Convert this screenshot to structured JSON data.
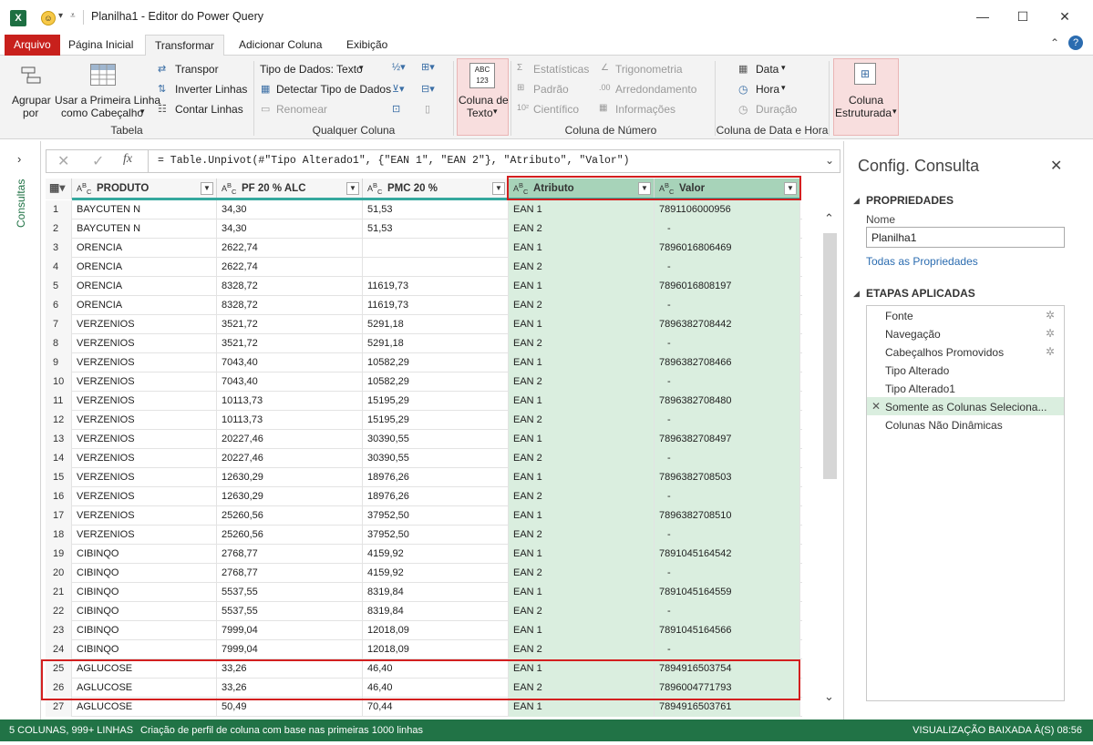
{
  "title": "Planilha1 - Editor do Power Query",
  "tabs": [
    "Arquivo",
    "Página Inicial",
    "Transformar",
    "Adicionar Coluna",
    "Exibição"
  ],
  "ribbon": {
    "agrupar": "Agrupar",
    "agrupar2": "por",
    "usar": "Usar a Primeira Linha",
    "usar2": "como Cabeçalho",
    "transpor": "Transpor",
    "inverter": "Inverter Linhas",
    "contar": "Contar Linhas",
    "tabela": "Tabela",
    "tipo_dados": "Tipo de Dados: Texto",
    "detectar": "Detectar Tipo de Dados",
    "renomear": "Renomear",
    "qualquer": "Qualquer Coluna",
    "coluna_de": "Coluna de",
    "texto": "Texto",
    "estatisticas": "Estatísticas",
    "padrao": "Padrão",
    "cientifico": "Científico",
    "trigonometria": "Trigonometria",
    "arredondamento": "Arredondamento",
    "informacoes": "Informações",
    "coluna_numero": "Coluna de Número",
    "data": "Data",
    "hora": "Hora",
    "duracao": "Duração",
    "coluna_data_hora": "Coluna de Data e Hora",
    "coluna": "Coluna",
    "estruturada": "Estruturada",
    "abc": "ABC",
    "n123": "123"
  },
  "consultas": "Consultas",
  "formula": "= Table.Unpivot(#\"Tipo Alterado1\", {\"EAN 1\", \"EAN 2\"}, \"Atributo\", \"Valor\")",
  "columns": [
    "PRODUTO",
    "PF 20 % ALC",
    "PMC 20 %",
    "Atributo",
    "Valor"
  ],
  "rows": [
    [
      "1",
      "BAYCUTEN N",
      "34,30",
      "51,53",
      "EAN 1",
      "7891106000956"
    ],
    [
      "2",
      "BAYCUTEN N",
      "34,30",
      "51,53",
      "EAN 2",
      "-"
    ],
    [
      "3",
      "ORENCIA",
      "2622,74",
      "",
      "EAN 1",
      "7896016806469"
    ],
    [
      "4",
      "ORENCIA",
      "2622,74",
      "",
      "EAN 2",
      "-"
    ],
    [
      "5",
      "ORENCIA",
      "8328,72",
      "11619,73",
      "EAN 1",
      "7896016808197"
    ],
    [
      "6",
      "ORENCIA",
      "8328,72",
      "11619,73",
      "EAN 2",
      "-"
    ],
    [
      "7",
      "VERZENIOS",
      "3521,72",
      "5291,18",
      "EAN 1",
      "7896382708442"
    ],
    [
      "8",
      "VERZENIOS",
      "3521,72",
      "5291,18",
      "EAN 2",
      "-"
    ],
    [
      "9",
      "VERZENIOS",
      "7043,40",
      "10582,29",
      "EAN 1",
      "7896382708466"
    ],
    [
      "10",
      "VERZENIOS",
      "7043,40",
      "10582,29",
      "EAN 2",
      "-"
    ],
    [
      "11",
      "VERZENIOS",
      "10113,73",
      "15195,29",
      "EAN 1",
      "7896382708480"
    ],
    [
      "12",
      "VERZENIOS",
      "10113,73",
      "15195,29",
      "EAN 2",
      "-"
    ],
    [
      "13",
      "VERZENIOS",
      "20227,46",
      "30390,55",
      "EAN 1",
      "7896382708497"
    ],
    [
      "14",
      "VERZENIOS",
      "20227,46",
      "30390,55",
      "EAN 2",
      "-"
    ],
    [
      "15",
      "VERZENIOS",
      "12630,29",
      "18976,26",
      "EAN 1",
      "7896382708503"
    ],
    [
      "16",
      "VERZENIOS",
      "12630,29",
      "18976,26",
      "EAN 2",
      "-"
    ],
    [
      "17",
      "VERZENIOS",
      "25260,56",
      "37952,50",
      "EAN 1",
      "7896382708510"
    ],
    [
      "18",
      "VERZENIOS",
      "25260,56",
      "37952,50",
      "EAN 2",
      "-"
    ],
    [
      "19",
      "CIBINQO",
      "2768,77",
      "4159,92",
      "EAN 1",
      "7891045164542"
    ],
    [
      "20",
      "CIBINQO",
      "2768,77",
      "4159,92",
      "EAN 2",
      "-"
    ],
    [
      "21",
      "CIBINQO",
      "5537,55",
      "8319,84",
      "EAN 1",
      "7891045164559"
    ],
    [
      "22",
      "CIBINQO",
      "5537,55",
      "8319,84",
      "EAN 2",
      "-"
    ],
    [
      "23",
      "CIBINQO",
      "7999,04",
      "12018,09",
      "EAN 1",
      "7891045164566"
    ],
    [
      "24",
      "CIBINQO",
      "7999,04",
      "12018,09",
      "EAN 2",
      "-"
    ],
    [
      "25",
      "AGLUCOSE",
      "33,26",
      "46,40",
      "EAN 1",
      "7894916503754"
    ],
    [
      "26",
      "AGLUCOSE",
      "33,26",
      "46,40",
      "EAN 2",
      "7896004771793"
    ],
    [
      "27",
      "AGLUCOSE",
      "50,49",
      "70,44",
      "EAN 1",
      "7894916503761"
    ]
  ],
  "panel": {
    "title": "Config. Consulta",
    "propriedades": "PROPRIEDADES",
    "nome_label": "Nome",
    "nome_value": "Planilha1",
    "todas": "Todas as Propriedades",
    "etapas": "ETAPAS APLICADAS",
    "steps": [
      "Fonte",
      "Navegação",
      "Cabeçalhos Promovidos",
      "Tipo Alterado",
      "Tipo Alterado1",
      "Somente as Colunas Seleciona...",
      "Colunas Não Dinâmicas"
    ]
  },
  "status": {
    "left": "5 COLUNAS, 999+ LINHAS",
    "profile": "Criação de perfil de coluna com base nas primeiras 1000 linhas",
    "right": "VISUALIZAÇÃO BAIXADA À(S) 08:56"
  }
}
